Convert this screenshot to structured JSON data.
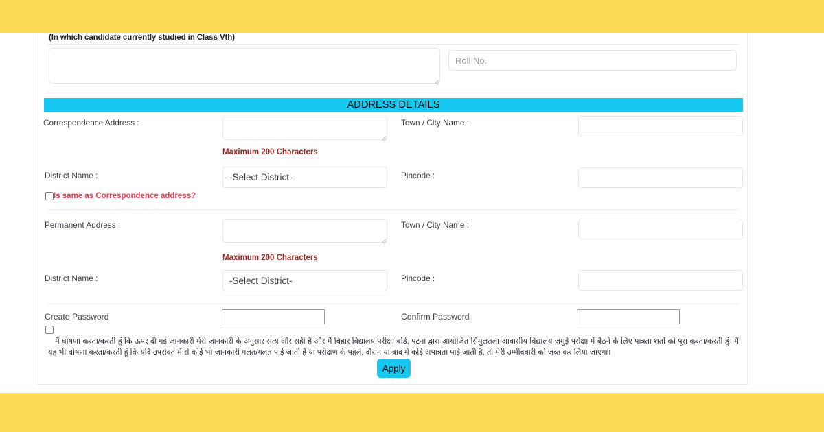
{
  "theme": {
    "band_color": "#fedb57",
    "banner_color": "#16c7f0",
    "accent_button_color": "#16c7f0",
    "warning_text_color": "#9c2420",
    "link_text_color": "#ee3b4e",
    "panel_background": "#ffffff"
  },
  "previous_section": {
    "caption": "(In which candidate currently studied in Class Vth)",
    "school_textarea_value": "",
    "roll_no_placeholder": "Roll No.",
    "roll_no_value": ""
  },
  "address_section": {
    "banner_title": "ADDRESS DETAILS",
    "correspondence": {
      "address_label": "Correspondence Address :",
      "address_value": "",
      "max_chars_note": "Maximum 200 Characters",
      "town_label": "Town / City Name :",
      "town_value": "",
      "district_label": "District Name :",
      "district_selected": "-Select District-",
      "district_options": [
        "-Select District-"
      ],
      "pincode_label": "Pincode :",
      "pincode_value": "",
      "same_as_label": "Is same as Correspondence address?",
      "same_as_checked": false
    },
    "permanent": {
      "address_label": "Permanent Address :",
      "address_value": "",
      "max_chars_note": "Maximum 200 Characters",
      "town_label": "Town / City Name :",
      "town_value": "",
      "district_label": "District Name :",
      "district_selected": "-Select District-",
      "district_options": [
        "-Select District-"
      ],
      "pincode_label": "Pincode :",
      "pincode_value": ""
    }
  },
  "password_section": {
    "create_password_label": "Create Password",
    "create_password_value": "",
    "confirm_password_label": "Confirm Password",
    "confirm_password_value": ""
  },
  "declaration": {
    "checked": false,
    "text": "मैं घोषणा करता/करती हूं कि ऊपर दी गई जानकारी मेरी जानकारी के अनुसार सत्य और सही है और मैं बिहार विद्यालय परीक्षा बोर्ड, पटना द्वारा आयोजित सिमुलतला आवासीय विद्यालय जमुई परीक्षा में बैठने के लिए पात्रता शर्तों को पूरा करता/करती हूं। मैं यह भी घोषणा करता/करती हूं कि यदि उपरोक्त में से कोई भी जानकारी गलत/गलत पाई जाती है या परीक्षण के पहले, दौरान या बाद में कोई अपात्रता पाई जाती है, तो मेरी उम्मीदवारी को जब्त कर लिया जाएगा।"
  },
  "actions": {
    "apply_label": "Apply"
  }
}
